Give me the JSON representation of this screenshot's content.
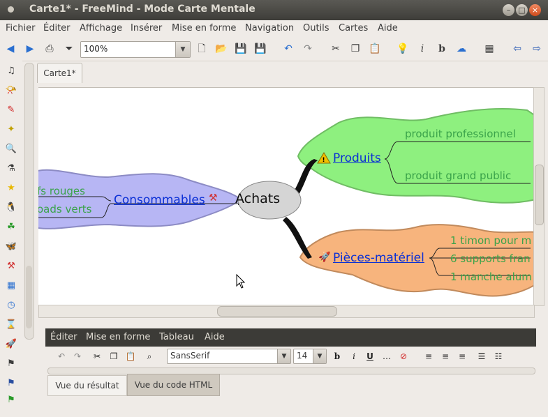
{
  "window": {
    "title": "Carte1* - FreeMind - Mode Carte Mentale"
  },
  "menubar": [
    "Fichier",
    "Éditer",
    "Affichage",
    "Insérer",
    "Mise en forme",
    "Navigation",
    "Outils",
    "Cartes",
    "Aide"
  ],
  "toolbar": {
    "zoom_value": "100%"
  },
  "tab": {
    "label": "Carte1*"
  },
  "map": {
    "root": "Achats",
    "nodes": {
      "produits": "Produits",
      "produit_pro": "produit professionnel",
      "produit_gp": "produit grand public",
      "consommables": "Consommables",
      "feutres": "fs rouges",
      "pads": "oads verts",
      "pieces": "Pièces-matériel",
      "timon": "1 timon pour m",
      "supports": "6 supports fran",
      "manche": "1 manche alum"
    },
    "colors": {
      "produits": "#8ef07f",
      "consommables": "#b7b6f4",
      "pieces": "#f7b47d",
      "root": "#d5d5d5",
      "link_text": "#0a2fd6",
      "child_text": "#3aa34a"
    }
  },
  "html_editor": {
    "menu": [
      "Éditer",
      "Mise en forme",
      "Tableau",
      "Aide"
    ],
    "font": "SansSerif",
    "size": "14",
    "tab_result": "Vue du résultat",
    "tab_html": "Vue du code HTML"
  },
  "icons": [
    "back-icon",
    "forward-icon",
    "print-icon",
    "filter-icon",
    "new-icon",
    "open-icon",
    "save-icon",
    "save-as-icon",
    "undo-icon",
    "redo-icon",
    "cut-icon",
    "copy-icon",
    "paste-icon",
    "idea-icon",
    "italic-icon",
    "bold-icon",
    "cloud-icon",
    "grid-icon",
    "prev-icon",
    "next-icon"
  ]
}
